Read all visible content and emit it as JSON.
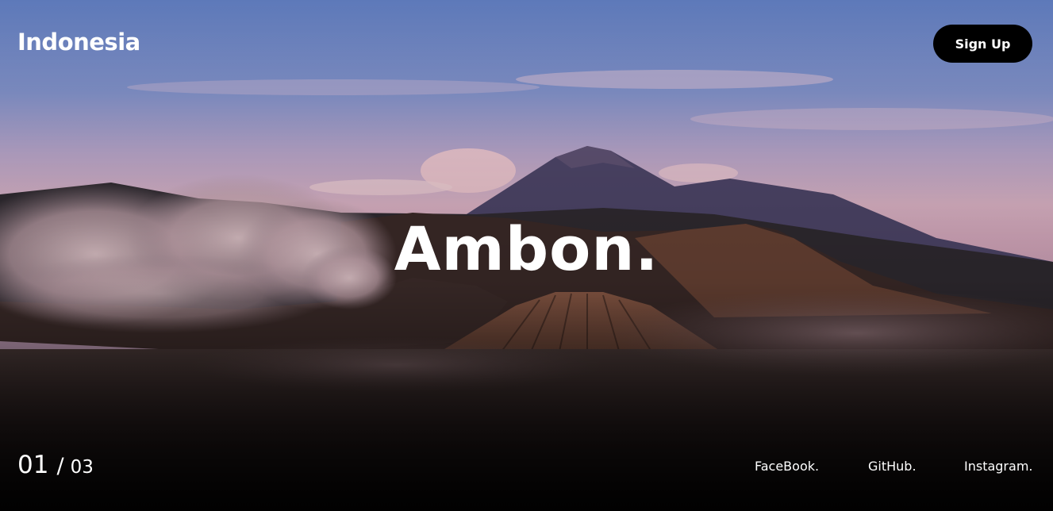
{
  "header": {
    "brand": "Indonesia",
    "signup_label": "Sign Up"
  },
  "hero": {
    "title": "Ambon.",
    "background_image": "volcano-landscape-illustration"
  },
  "slider": {
    "current": "01",
    "separator": "/",
    "total": "03"
  },
  "social": {
    "facebook": "FaceBook.",
    "github": "GitHub.",
    "instagram": "Instagram."
  },
  "colors": {
    "sky_top": "#5f79b8",
    "sky_mid": "#b7a3c6",
    "horizon": "#e8b9c4",
    "button_bg": "#000000",
    "text": "#ffffff"
  }
}
